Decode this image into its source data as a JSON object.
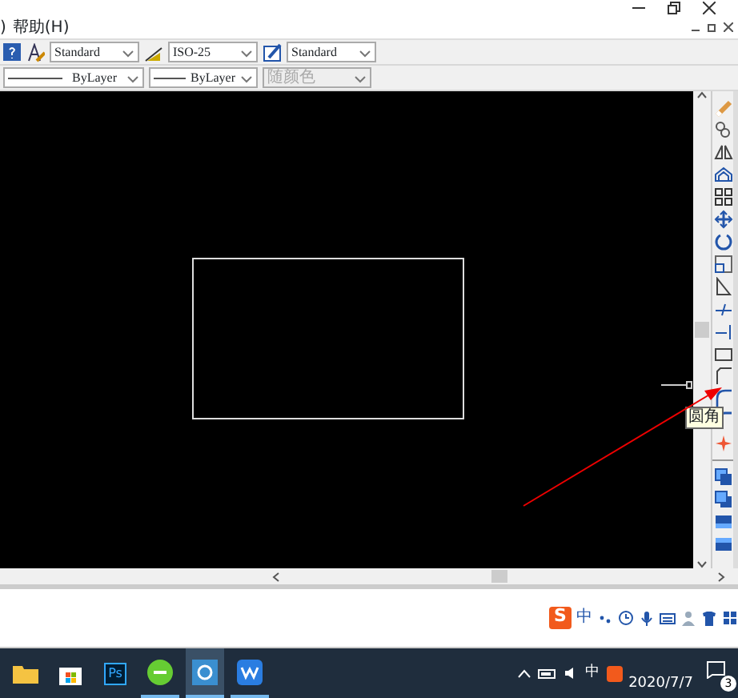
{
  "menu": [
    ")",
    "帮助(H)"
  ],
  "styles_toolbar": [
    {
      "kind": "text",
      "value": "Standard"
    },
    {
      "kind": "dim",
      "value": "ISO-25"
    },
    {
      "kind": "table",
      "value": "Standard"
    }
  ],
  "properties_toolbar": [
    {
      "kind": "linetype",
      "value": "ByLayer",
      "disabled": false
    },
    {
      "kind": "lineweight",
      "value": "ByLayer",
      "disabled": false
    },
    {
      "kind": "color",
      "value": "随颜色",
      "disabled": true
    }
  ],
  "tooltip": "圆角",
  "ime_bar": {
    "logo": "S",
    "mode": "中"
  },
  "taskbar": {
    "apps": [
      {
        "kind": "explorer",
        "running": false,
        "selected": false
      },
      {
        "kind": "store",
        "running": false,
        "selected": false
      },
      {
        "kind": "photoshop",
        "label": "Ps",
        "running": false,
        "selected": false
      },
      {
        "kind": "green",
        "running": true,
        "selected": false
      },
      {
        "kind": "cad",
        "running": true,
        "selected": true
      },
      {
        "kind": "wps",
        "running": true,
        "selected": false
      }
    ],
    "ime": "中",
    "date": "2020/7/7",
    "notifications": "3"
  }
}
